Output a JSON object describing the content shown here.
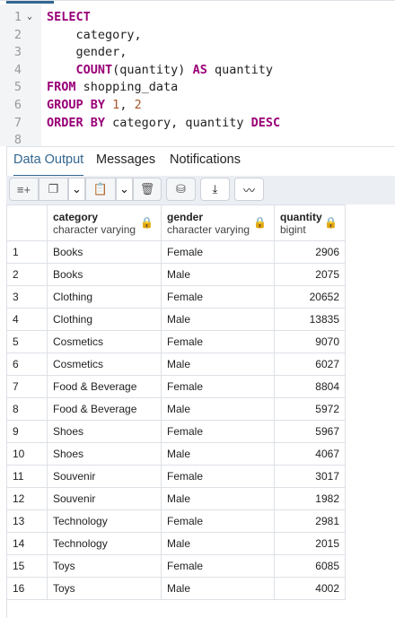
{
  "editor": {
    "lines": [
      {
        "n": "1",
        "fold": true,
        "tokens": [
          [
            "kw",
            "SELECT"
          ]
        ]
      },
      {
        "n": "2",
        "tokens": [
          [
            "",
            "    category,"
          ]
        ]
      },
      {
        "n": "3",
        "tokens": [
          [
            "",
            "    gender,"
          ]
        ]
      },
      {
        "n": "4",
        "tokens": [
          [
            "",
            "    "
          ],
          [
            "kw",
            "COUNT"
          ],
          [
            "",
            "(quantity) "
          ],
          [
            "kw",
            "AS"
          ],
          [
            "",
            " quantity"
          ]
        ]
      },
      {
        "n": "5",
        "tokens": [
          [
            "kw",
            "FROM"
          ],
          [
            "",
            " shopping_data"
          ]
        ]
      },
      {
        "n": "6",
        "tokens": [
          [
            "kw",
            "GROUP BY"
          ],
          [
            "",
            " "
          ],
          [
            "num",
            "1"
          ],
          [
            "",
            ", "
          ],
          [
            "num",
            "2"
          ]
        ]
      },
      {
        "n": "7",
        "tokens": [
          [
            "kw",
            "ORDER BY"
          ],
          [
            "",
            " category, quantity "
          ],
          [
            "kw",
            "DESC"
          ]
        ]
      },
      {
        "n": "8",
        "tokens": []
      }
    ]
  },
  "tabs": [
    "Data Output",
    "Messages",
    "Notifications"
  ],
  "active_tab": "Data Output",
  "toolbar": {
    "add_row": "≡+",
    "copy": "❐",
    "dropdown": "⌄",
    "paste": "📋",
    "delete": "🗑",
    "save_data": "⛁",
    "download": "⤓",
    "graph": "〰"
  },
  "columns": [
    {
      "name": "category",
      "type": "character varying"
    },
    {
      "name": "gender",
      "type": "character varying"
    },
    {
      "name": "quantity",
      "type": "bigint"
    }
  ],
  "rows": [
    [
      "1",
      "Books",
      "Female",
      "2906"
    ],
    [
      "2",
      "Books",
      "Male",
      "2075"
    ],
    [
      "3",
      "Clothing",
      "Female",
      "20652"
    ],
    [
      "4",
      "Clothing",
      "Male",
      "13835"
    ],
    [
      "5",
      "Cosmetics",
      "Female",
      "9070"
    ],
    [
      "6",
      "Cosmetics",
      "Male",
      "6027"
    ],
    [
      "7",
      "Food & Beverage",
      "Female",
      "8804"
    ],
    [
      "8",
      "Food & Beverage",
      "Male",
      "5972"
    ],
    [
      "9",
      "Shoes",
      "Female",
      "5967"
    ],
    [
      "10",
      "Shoes",
      "Male",
      "4067"
    ],
    [
      "11",
      "Souvenir",
      "Female",
      "3017"
    ],
    [
      "12",
      "Souvenir",
      "Male",
      "1982"
    ],
    [
      "13",
      "Technology",
      "Female",
      "2981"
    ],
    [
      "14",
      "Technology",
      "Male",
      "2015"
    ],
    [
      "15",
      "Toys",
      "Female",
      "6085"
    ],
    [
      "16",
      "Toys",
      "Male",
      "4002"
    ]
  ],
  "colors": {
    "accent": "#326690",
    "keyword": "#990077",
    "number": "#a5572a"
  }
}
